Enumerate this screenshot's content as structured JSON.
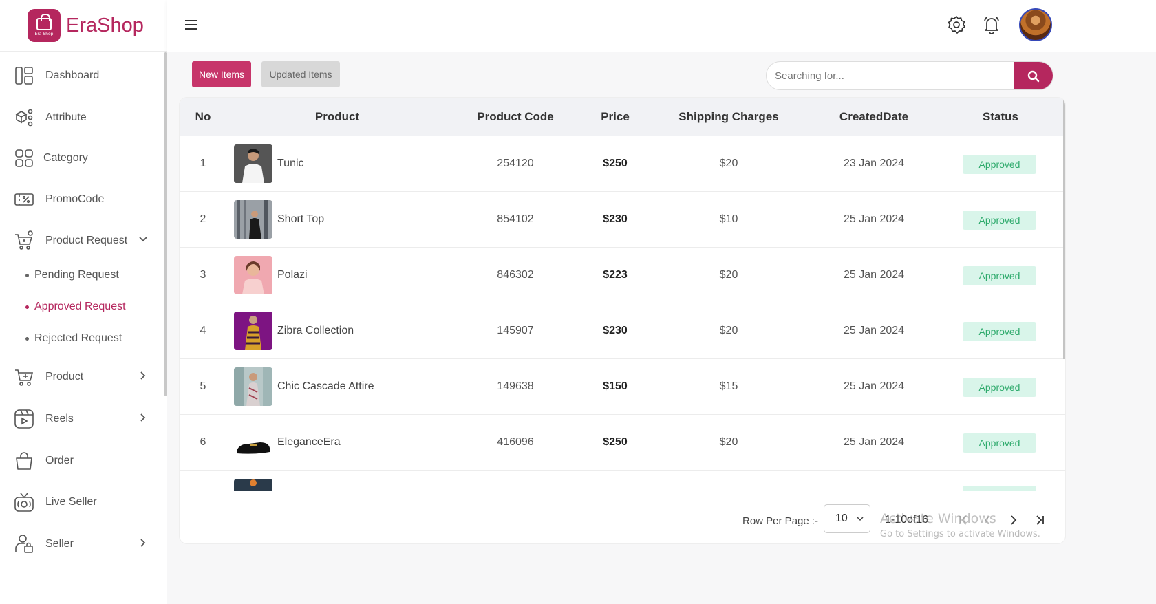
{
  "brand": {
    "name": "EraShop",
    "logo_tiny": "Era Shop"
  },
  "sidebar": {
    "items": [
      {
        "label": "Dashboard",
        "icon": "dashboard-icon"
      },
      {
        "label": "Attribute",
        "icon": "attribute-icon"
      },
      {
        "label": "Category",
        "icon": "category-icon"
      },
      {
        "label": "PromoCode",
        "icon": "promocode-icon"
      },
      {
        "label": "Product Request",
        "icon": "product-request-icon",
        "expanded": true
      },
      {
        "label": "Product",
        "icon": "product-icon"
      },
      {
        "label": "Reels",
        "icon": "reels-icon"
      },
      {
        "label": "Order",
        "icon": "order-icon"
      },
      {
        "label": "Live Seller",
        "icon": "live-seller-icon"
      },
      {
        "label": "Seller",
        "icon": "seller-icon"
      }
    ],
    "sub_items": [
      {
        "label": "Pending Request",
        "active": false
      },
      {
        "label": "Approved Request",
        "active": true
      },
      {
        "label": "Rejected Request",
        "active": false
      }
    ]
  },
  "header": {
    "icons": [
      "menu-icon",
      "settings-icon",
      "bell-icon"
    ]
  },
  "tabs": {
    "new_label": "New Items",
    "updated_label": "Updated Items"
  },
  "search": {
    "placeholder": "Searching for..."
  },
  "table": {
    "columns": [
      "No",
      "Product",
      "Product Code",
      "Price",
      "Shipping Charges",
      "CreatedDate",
      "Status"
    ],
    "rows": [
      {
        "no": "1",
        "product": "Tunic",
        "code": "254120",
        "price": "$250",
        "shipping": "$20",
        "date": "23 Jan 2024",
        "status": "Approved"
      },
      {
        "no": "2",
        "product": "Short Top",
        "code": "854102",
        "price": "$230",
        "shipping": "$10",
        "date": "25 Jan 2024",
        "status": "Approved"
      },
      {
        "no": "3",
        "product": "Polazi",
        "code": "846302",
        "price": "$223",
        "shipping": "$20",
        "date": "25 Jan 2024",
        "status": "Approved"
      },
      {
        "no": "4",
        "product": "Zibra Collection",
        "code": "145907",
        "price": "$230",
        "shipping": "$20",
        "date": "25 Jan 2024",
        "status": "Approved"
      },
      {
        "no": "5",
        "product": "Chic Cascade Attire",
        "code": "149638",
        "price": "$150",
        "shipping": "$15",
        "date": "25 Jan 2024",
        "status": "Approved"
      },
      {
        "no": "6",
        "product": "EleganceEra",
        "code": "416096",
        "price": "$250",
        "shipping": "$20",
        "date": "25 Jan 2024",
        "status": "Approved"
      }
    ]
  },
  "pagination": {
    "rows_label": "Row Per Page :-",
    "rows_value": "10",
    "range": "1-10of16"
  },
  "watermark": {
    "line1": "Activate Windows",
    "line2": "Go to Settings to activate Windows."
  },
  "colors": {
    "accent": "#b5275e",
    "approved_bg": "#d9f5ea",
    "approved_text": "#2eaa6c"
  }
}
